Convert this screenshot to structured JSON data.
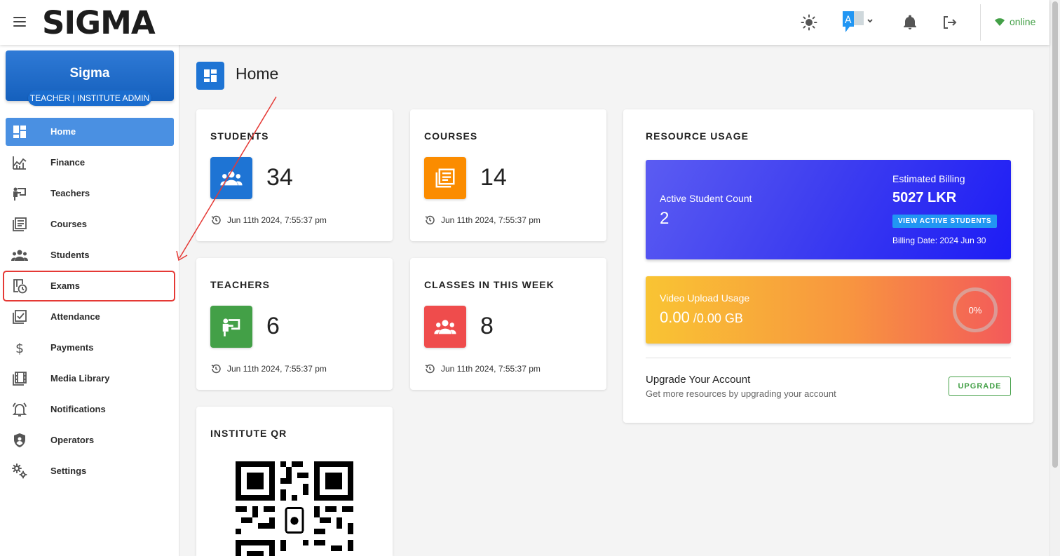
{
  "app": {
    "logo": "SIGMA",
    "connection_status": "online",
    "colors": {
      "primary": "#1e74d4",
      "online": "#43a047"
    }
  },
  "topbar": {
    "icons": [
      "theme-toggle-icon",
      "language-icon",
      "notification-bell-icon",
      "logout-icon",
      "wifi-icon"
    ],
    "language_badge": "A"
  },
  "profile": {
    "name": "Sigma",
    "role": "TEACHER | INSTITUTE ADMIN"
  },
  "nav": {
    "items": [
      {
        "label": "Home",
        "icon": "dashboard-icon",
        "active": true
      },
      {
        "label": "Finance",
        "icon": "finance-chart-icon"
      },
      {
        "label": "Teachers",
        "icon": "teacher-icon"
      },
      {
        "label": "Courses",
        "icon": "courses-icon"
      },
      {
        "label": "Students",
        "icon": "students-icon"
      },
      {
        "label": "Exams",
        "icon": "exams-icon",
        "highlighted": true
      },
      {
        "label": "Attendance",
        "icon": "attendance-icon"
      },
      {
        "label": "Payments",
        "icon": "dollar-icon"
      },
      {
        "label": "Media Library",
        "icon": "media-library-icon"
      },
      {
        "label": "Notifications",
        "icon": "notifications-icon"
      },
      {
        "label": "Operators",
        "icon": "shield-icon"
      },
      {
        "label": "Settings",
        "icon": "settings-gear-icon"
      }
    ]
  },
  "page": {
    "title": "Home"
  },
  "stats": {
    "students": {
      "title": "STUDENTS",
      "value": "34",
      "updated": "Jun 11th 2024, 7:55:37 pm",
      "color": "#1e74d4"
    },
    "courses": {
      "title": "COURSES",
      "value": "14",
      "updated": "Jun 11th 2024, 7:55:37 pm",
      "color": "#fb8c00"
    },
    "teachers": {
      "title": "TEACHERS",
      "value": "6",
      "updated": "Jun 11th 2024, 7:55:37 pm",
      "color": "#43a047"
    },
    "classes": {
      "title": "CLASSES IN THIS WEEK",
      "value": "8",
      "updated": "Jun 11th 2024, 7:55:37 pm",
      "color": "#ef4c4c"
    }
  },
  "qr": {
    "title": "INSTITUTE QR"
  },
  "resource_usage": {
    "title": "RESOURCE USAGE",
    "active_student_label": "Active Student Count",
    "active_student_value": "2",
    "estimated_billing_label": "Estimated Billing",
    "estimated_billing_value": "5027 LKR",
    "view_button": "VIEW ACTIVE STUDENTS",
    "billing_date": "Billing Date: 2024 Jun 30",
    "video_label": "Video Upload Usage",
    "video_used": "0.00",
    "video_total": " /0.00 GB",
    "video_percent": "0%",
    "upgrade_title": "Upgrade Your Account",
    "upgrade_sub": "Get more resources by upgrading your account",
    "upgrade_button": "UPGRADE"
  }
}
